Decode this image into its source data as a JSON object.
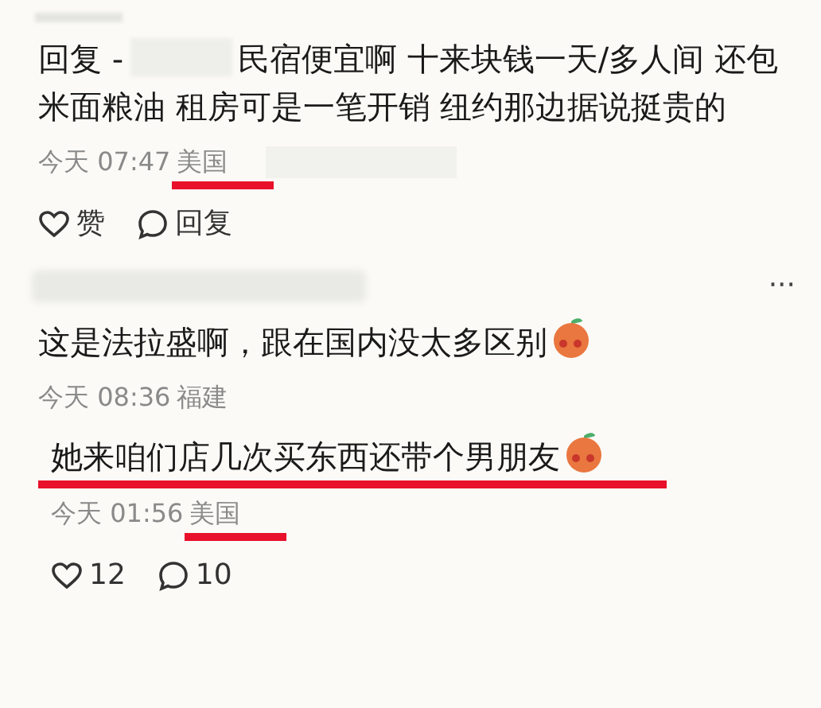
{
  "comments": [
    {
      "reply_prefix": "回复 -",
      "body": "民宿便宜啊 十来块钱一天/多人间 还包米面粮油 租房可是一笔开销 纽约那边据说挺贵的",
      "time": "今天 07:47",
      "location": "美国",
      "location_underlined": true,
      "like": "赞",
      "reply": "回复"
    },
    {
      "body": "这是法拉盛啊，跟在国内没太多区别",
      "emoji": true,
      "time": "今天 08:36",
      "location": "福建",
      "more": "···",
      "children": [
        {
          "body": "她来咱们店几次买东西还带个男朋友",
          "emoji": true,
          "underlined": true,
          "time": "今天 01:56",
          "location": "美国",
          "location_underlined": true,
          "like": "12",
          "reply": "10"
        }
      ]
    }
  ]
}
